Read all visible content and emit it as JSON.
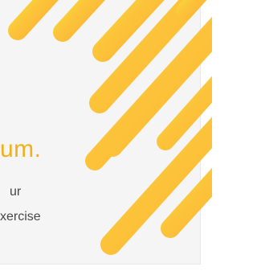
{
  "card": {
    "headline": "um.",
    "body_lines": [
      "ur",
      "xercise"
    ]
  },
  "colors": {
    "card_background": "#f5f5f5",
    "headline": "#f1b01c",
    "body_text": "#474747",
    "stripe_yellow": "#f4e537",
    "stripe_orange": "#fbb035"
  }
}
